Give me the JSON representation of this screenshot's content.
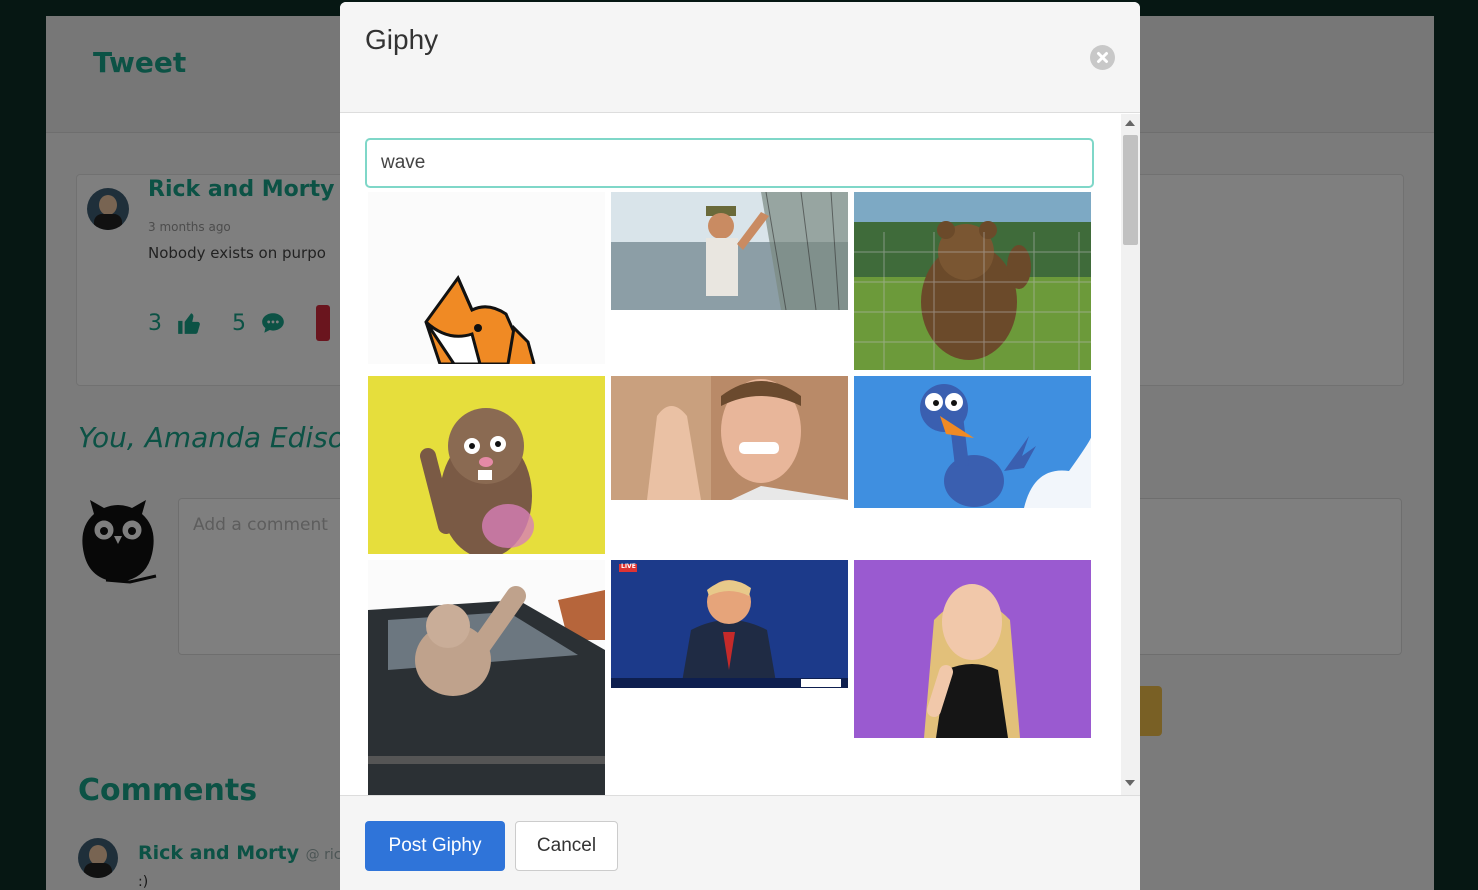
{
  "background": {
    "page_title": "Tweet",
    "tweet": {
      "author": "Rick and Morty",
      "handle": "@",
      "time": "3 months ago",
      "text": "Nobody exists on purpo",
      "likes": "3",
      "comments": "5"
    },
    "you_line": "You, Amanda Ediso",
    "comment_placeholder": "Add a comment",
    "comments_title": "Comments",
    "comment": {
      "author": "Rick and Morty",
      "handle": "@ rickan",
      "text": ":)"
    }
  },
  "modal": {
    "title": "Giphy",
    "close_icon": "close-circle-icon",
    "search": {
      "value": "wave"
    },
    "gifs": [
      {
        "subject": "fox"
      },
      {
        "subject": "fisherman-waving"
      },
      {
        "subject": "bear-waving"
      },
      {
        "subject": "puppet-waving"
      },
      {
        "subject": "man-waving"
      },
      {
        "subject": "blue-bird-waving"
      },
      {
        "subject": "dog-in-car-window"
      },
      {
        "subject": "trump-waving",
        "caption": "LIVE"
      },
      {
        "subject": "woman-waving"
      }
    ],
    "footer": {
      "post_label": "Post Giphy",
      "cancel_label": "Cancel"
    }
  },
  "colors": {
    "accent": "#18a48a",
    "primary_button": "#2f74d9",
    "input_focus": "#7fd7c8"
  }
}
